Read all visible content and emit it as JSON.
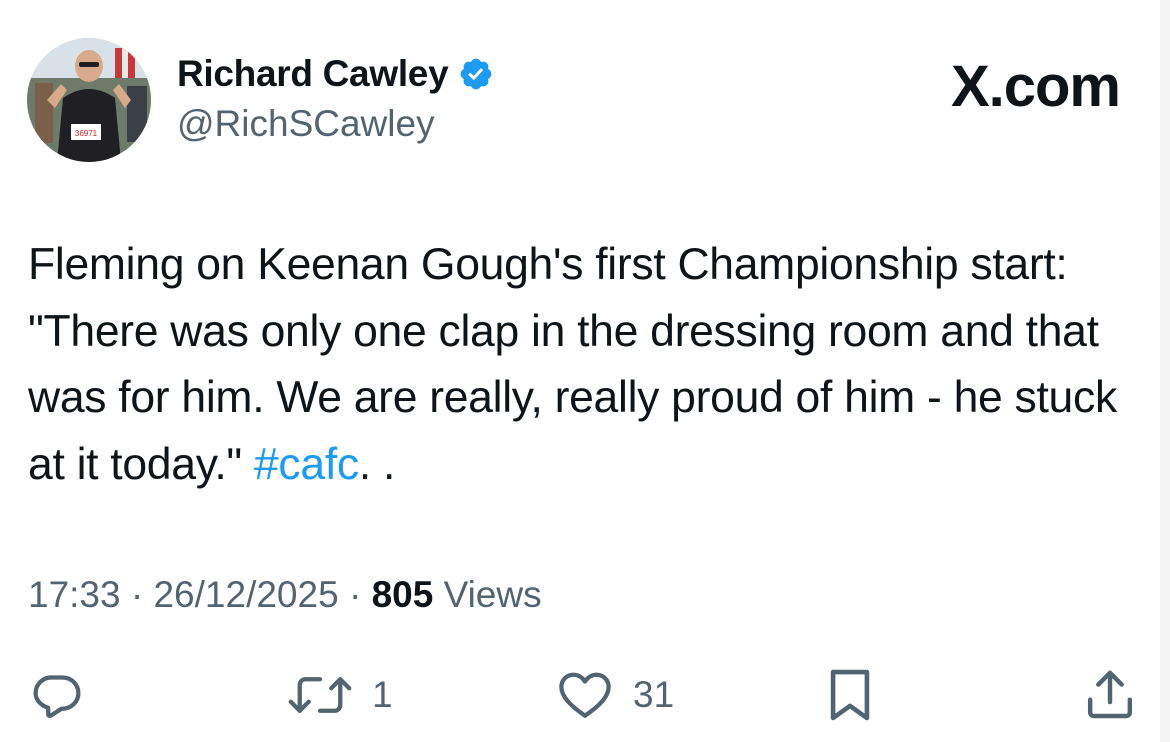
{
  "author": {
    "display_name": "Richard Cawley",
    "handle": "@RichSCawley",
    "verified": true
  },
  "brand": {
    "label": "X.com"
  },
  "tweet": {
    "text_segments": [
      "Fleming on Keenan Gough's first Championship start: \"There was only one clap in the dressing room and that was for him. We are really, really proud of him - he stuck at it today.\" ",
      "#cafc",
      ".  ."
    ]
  },
  "meta": {
    "time": "17:33",
    "separator": "·",
    "date": "26/12/2025",
    "views_count": "805",
    "views_label": "Views"
  },
  "actions": {
    "reply_icon": "reply-icon",
    "retweet_icon": "retweet-icon",
    "retweet_count": "1",
    "like_icon": "like-icon",
    "like_count": "31",
    "bookmark_icon": "bookmark-icon",
    "share_icon": "share-icon"
  },
  "colors": {
    "accent": "#1d9bf0",
    "text": "#0f1419",
    "secondary": "#536471"
  }
}
